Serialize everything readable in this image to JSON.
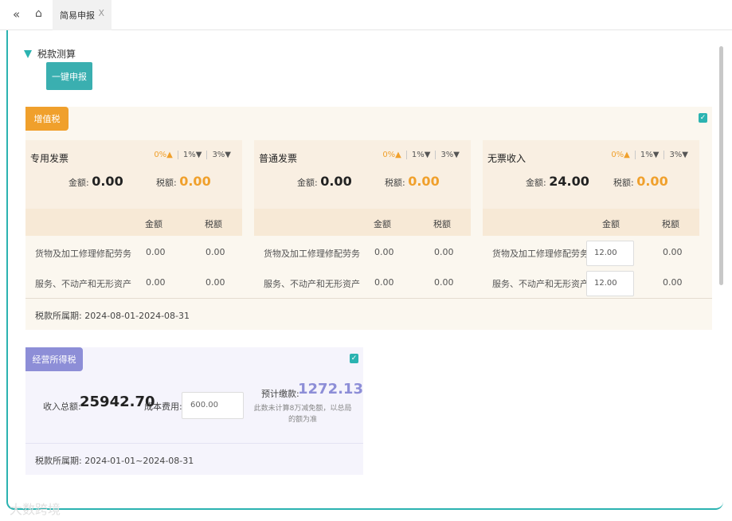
{
  "tabbar": {
    "back_icon": "double-chevron-left-icon",
    "home_icon": "home-icon",
    "active_tab_label": "简易申报",
    "close_label": "X"
  },
  "section": {
    "title": "税款测算",
    "declare_button": "一键申报"
  },
  "vat": {
    "tag": "增值税",
    "checked_mark": "✓",
    "cards": [
      {
        "name": "专用发票",
        "rates": [
          "0%▲",
          "1%▼",
          "3%▼"
        ],
        "amount_label": "金额:",
        "amount": "0.00",
        "tax_label": "税额:",
        "tax": "0.00",
        "col_amount": "金额",
        "col_tax": "税额",
        "rows": [
          {
            "label": "货物及加工修理修配劳务",
            "amount": "0.00",
            "tax": "0.00"
          },
          {
            "label": "服务、不动产和无形资产",
            "amount": "0.00",
            "tax": "0.00"
          }
        ]
      },
      {
        "name": "普通发票",
        "rates": [
          "0%▲",
          "1%▼",
          "3%▼"
        ],
        "amount_label": "金额:",
        "amount": "0.00",
        "tax_label": "税额:",
        "tax": "0.00",
        "col_amount": "金额",
        "col_tax": "税额",
        "rows": [
          {
            "label": "货物及加工修理修配劳务",
            "amount": "0.00",
            "tax": "0.00"
          },
          {
            "label": "服务、不动产和无形资产",
            "amount": "0.00",
            "tax": "0.00"
          }
        ]
      },
      {
        "name": "无票收入",
        "rates": [
          "0%▲",
          "1%▼",
          "3%▼"
        ],
        "amount_label": "金额:",
        "amount": "24.00",
        "tax_label": "税额:",
        "tax": "0.00",
        "col_amount": "金额",
        "col_tax": "税额",
        "rows": [
          {
            "label": "货物及加工修理修配劳务",
            "amount": "12.00",
            "tax": "0.00"
          },
          {
            "label": "服务、不动产和无形资产",
            "amount": "12.00",
            "tax": "0.00"
          }
        ]
      }
    ],
    "period": "税款所属期: 2024-08-01-2024-08-31"
  },
  "biz": {
    "tag": "经营所得税",
    "checked_mark": "✓",
    "income_label": "收入总额:",
    "income": "25942.70",
    "cost_label": "成本费用:",
    "cost_value": "600.00",
    "tax_label": "预计缴款:",
    "tax": "1272.13",
    "note": "此数未计算8万减免额，以总局的额为准",
    "period": "税款所属期: 2024-01-01~2024-08-31"
  },
  "watermark": "大数跨境",
  "colors": {
    "teal": "#2bb3b1",
    "orange": "#f0a02c",
    "purple": "#8d8ed7"
  }
}
